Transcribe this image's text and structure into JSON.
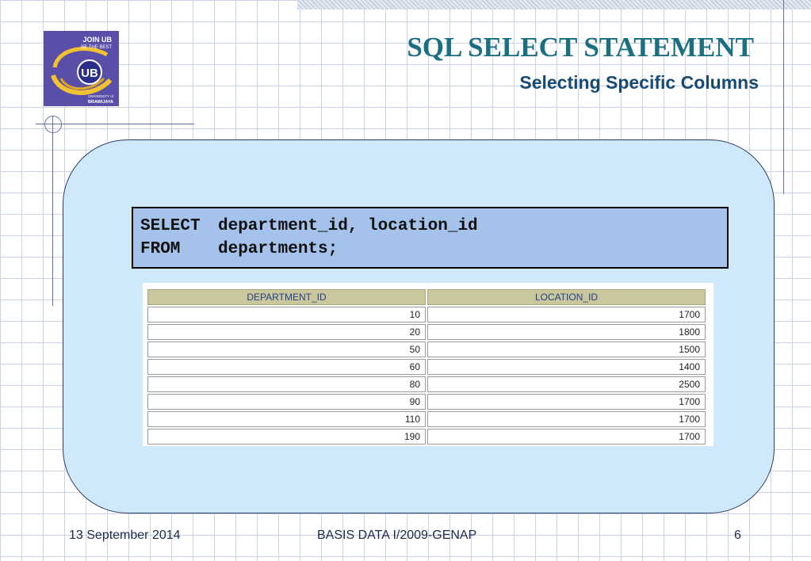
{
  "logo": {
    "line1": "JOIN UB",
    "line2": "BE THE BEST",
    "mark": "UB",
    "bottom1": "UNIVERSITY of",
    "bottom2": "BRAWIJAYA"
  },
  "header": {
    "title": "SQL SELECT STATEMENT",
    "subtitle": "Selecting Specific Columns"
  },
  "code": {
    "line1_keyword": "SELECT",
    "line1_rest": "department_id, location_id",
    "line2_keyword": "FROM",
    "line2_rest": "departments;"
  },
  "result": {
    "columns": [
      "DEPARTMENT_ID",
      "LOCATION_ID"
    ],
    "rows": [
      [
        "10",
        "1700"
      ],
      [
        "20",
        "1800"
      ],
      [
        "50",
        "1500"
      ],
      [
        "60",
        "1400"
      ],
      [
        "80",
        "2500"
      ],
      [
        "90",
        "1700"
      ],
      [
        "110",
        "1700"
      ],
      [
        "190",
        "1700"
      ]
    ]
  },
  "footer": {
    "date": "13 September 2014",
    "center": "BASIS DATA I/2009-GENAP",
    "page": "6"
  },
  "colors": {
    "title": "#1a6f80",
    "subtitle": "#174a72",
    "panel": "#cfe9fb",
    "code_box": "#a4c2ea",
    "table_header": "#cbc79c",
    "logo_bg": "#5a4fa8"
  }
}
